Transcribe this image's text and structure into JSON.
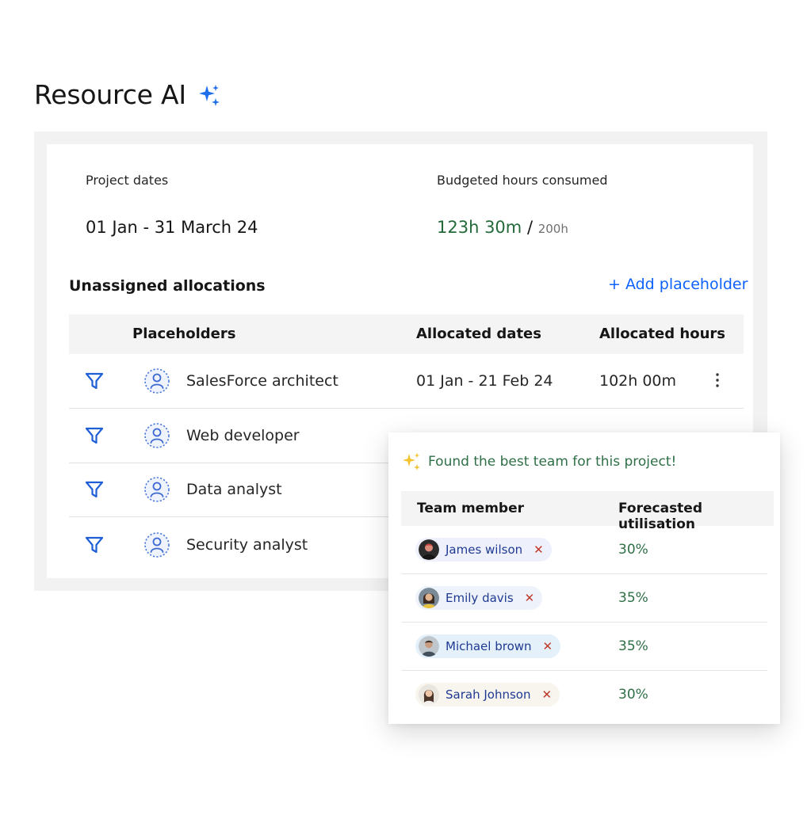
{
  "title": "Resource AI",
  "project": {
    "dates_label": "Project dates",
    "dates_value": "01 Jan - 31 March 24",
    "budget_label": "Budgeted hours consumed",
    "budget_consumed": "123h 30m",
    "budget_separator": "/",
    "budget_total": "200h"
  },
  "allocations": {
    "title": "Unassigned allocations",
    "add_label": "+ Add placeholder",
    "columns": [
      "Placeholders",
      "Allocated dates",
      "Allocated hours"
    ],
    "rows": [
      {
        "placeholder": "SalesForce architect",
        "dates": "01 Jan - 21 Feb 24",
        "hours": "102h 00m"
      },
      {
        "placeholder": "Web developer"
      },
      {
        "placeholder": "Data analyst"
      },
      {
        "placeholder": "Security analyst"
      }
    ]
  },
  "suggestion": {
    "message": "Found the best team for this project!",
    "columns": [
      "Team member",
      "Forecasted utilisation"
    ],
    "members": [
      {
        "name": "James wilson",
        "utilisation": "30%"
      },
      {
        "name": "Emily davis",
        "utilisation": "35%"
      },
      {
        "name": "Michael brown",
        "utilisation": "35%"
      },
      {
        "name": "Sarah Johnson",
        "utilisation": "30%"
      }
    ],
    "remove_symbol": "✕"
  },
  "colors": {
    "accent": "#0f62fe",
    "consumed": "#24693a",
    "utilisation": "#2f6f47",
    "remove": "#c0392b"
  }
}
